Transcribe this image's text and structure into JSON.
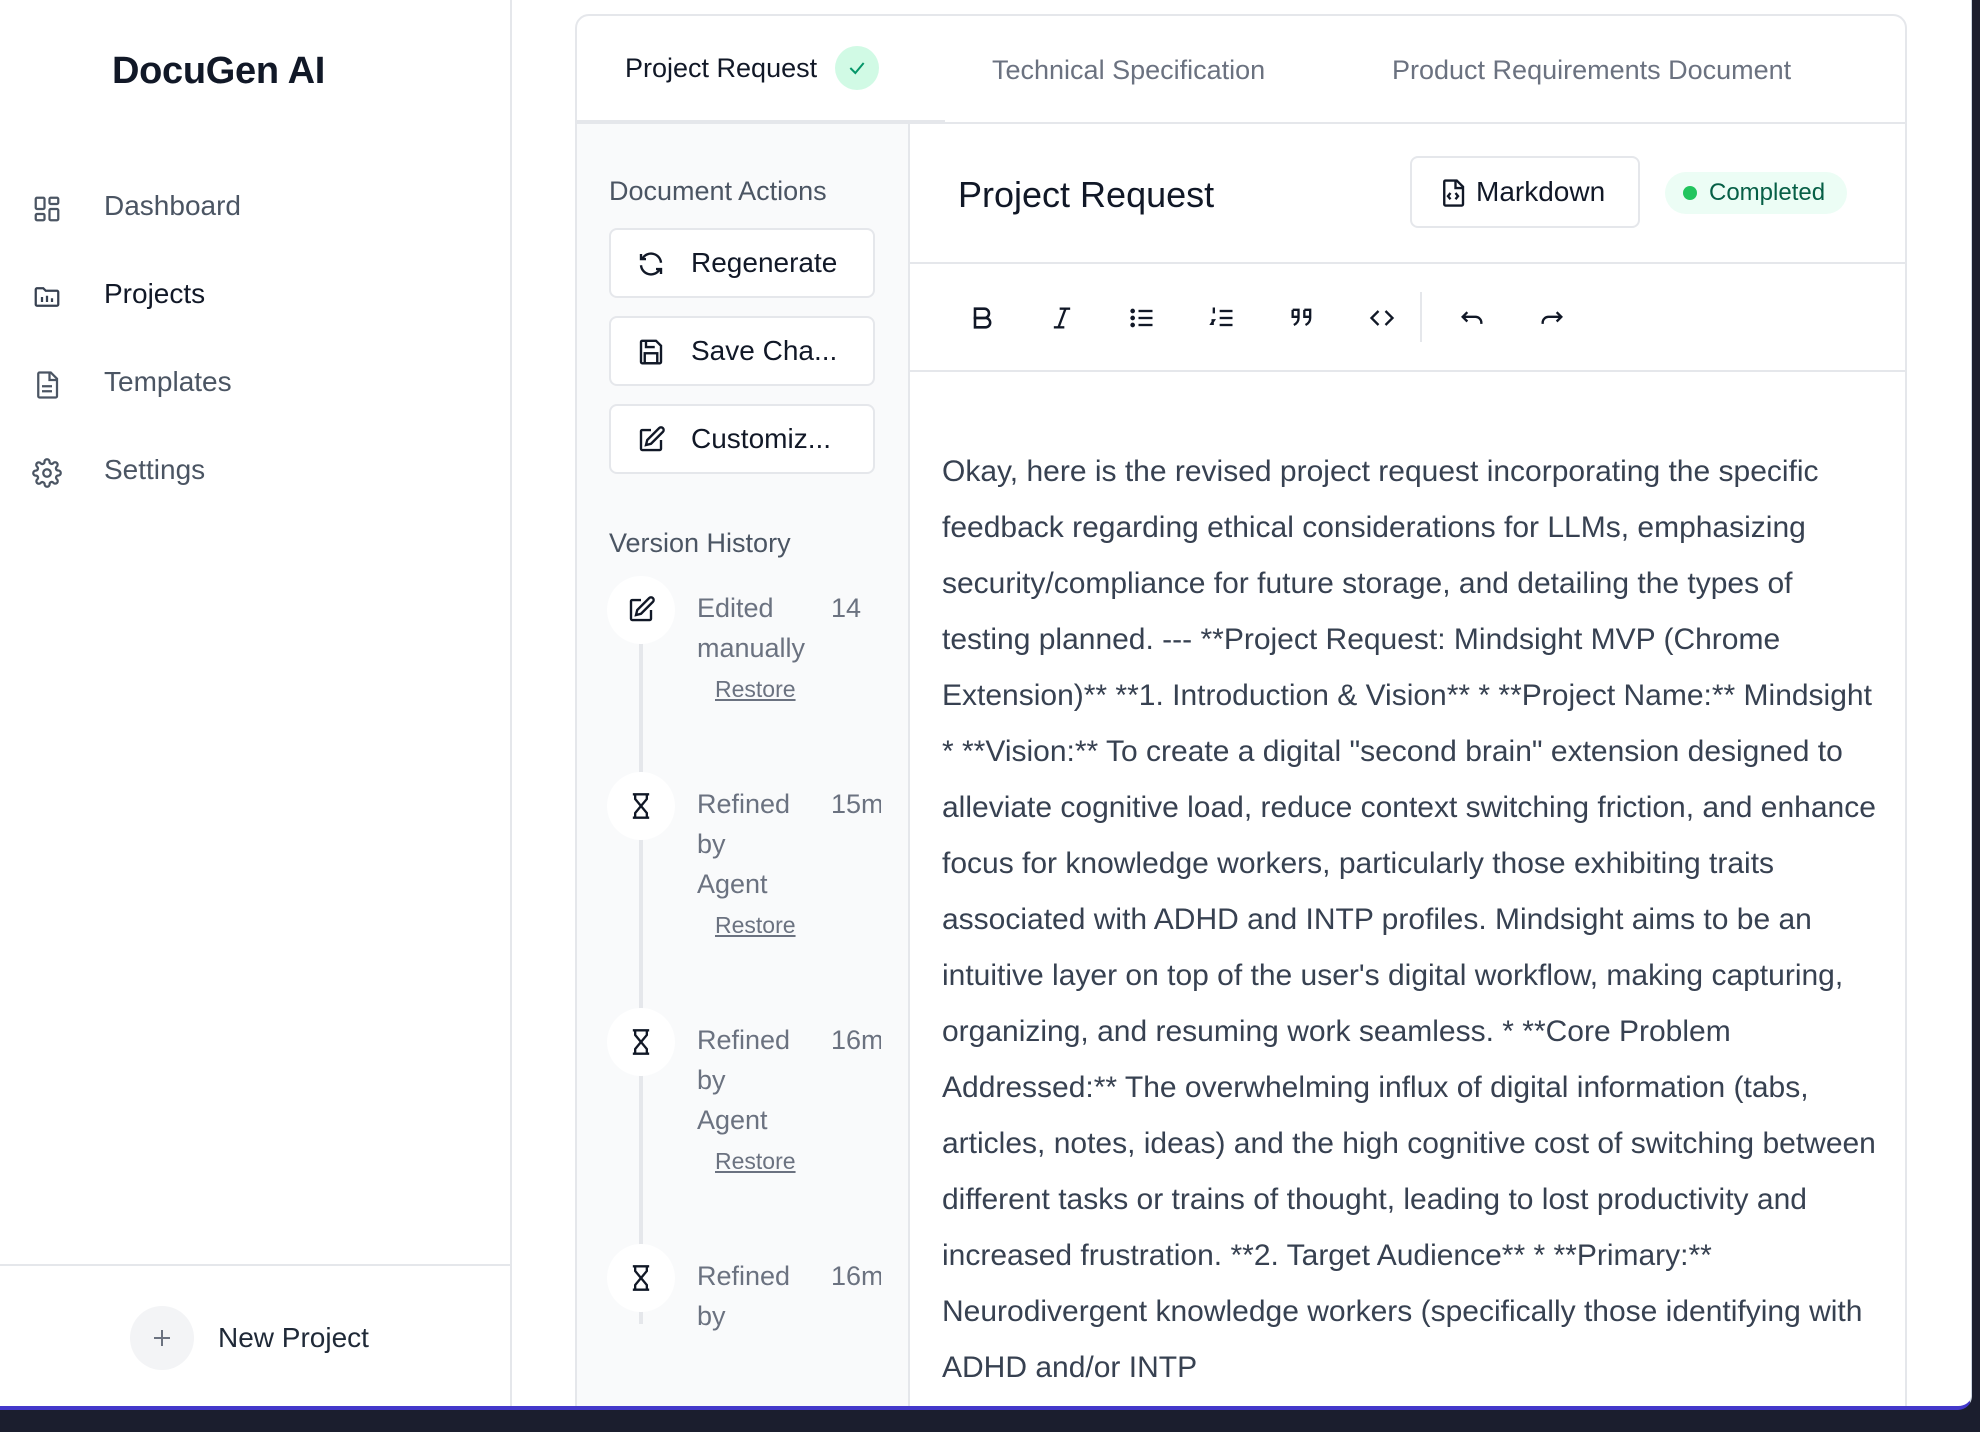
{
  "app": {
    "title": "DocuGen AI"
  },
  "sidebar": {
    "items": [
      {
        "label": "Dashboard",
        "icon": "dashboard-icon"
      },
      {
        "label": "Projects",
        "icon": "folder-icon"
      },
      {
        "label": "Templates",
        "icon": "document-icon"
      },
      {
        "label": "Settings",
        "icon": "gear-icon"
      }
    ],
    "active": "Projects",
    "new_project_label": "New Project"
  },
  "tabs": [
    {
      "label": "Project Request",
      "active": true,
      "completed": true
    },
    {
      "label": "Technical Specification",
      "active": false
    },
    {
      "label": "Product Requirements Document",
      "active": false
    }
  ],
  "actions": {
    "title": "Document Actions",
    "buttons": [
      {
        "label": "Regenerate",
        "icon": "refresh-icon"
      },
      {
        "label": "Save Cha...",
        "icon": "save-icon"
      },
      {
        "label": "Customiz...",
        "icon": "edit-icon"
      }
    ]
  },
  "version_history": {
    "title": "Version History",
    "items": [
      {
        "lines": [
          "Edited",
          "manually"
        ],
        "time": "14",
        "icon": "edit-icon",
        "restore": "Restore"
      },
      {
        "lines": [
          "Refined",
          "by",
          "Agent"
        ],
        "time": "15m",
        "icon": "hourglass-icon",
        "restore": "Restore"
      },
      {
        "lines": [
          "Refined",
          "by",
          "Agent"
        ],
        "time": "16m",
        "icon": "hourglass-icon",
        "restore": "Restore"
      },
      {
        "lines": [
          "Refined",
          "by"
        ],
        "time": "16m",
        "icon": "hourglass-icon"
      }
    ]
  },
  "document": {
    "title": "Project Request",
    "format_button": "Markdown",
    "status": "Completed",
    "status_color": "#22c55e",
    "body": "Okay, here is the revised project request incorporating the specific feedback regarding ethical considerations for LLMs, emphasizing security/compliance for future storage, and detailing the types of testing planned. --- **Project Request: Mindsight MVP (Chrome Extension)** **1. Introduction & Vision** * **Project Name:** Mindsight * **Vision:** To create a digital \"second brain\" extension designed to alleviate cognitive load, reduce context switching friction, and enhance focus for knowledge workers, particularly those exhibiting traits associated with ADHD and INTP profiles. Mindsight aims to be an intuitive layer on top of the user's digital workflow, making capturing, organizing, and resuming work seamless. * **Core Problem Addressed:** The overwhelming influx of digital information (tabs, articles, notes, ideas) and the high cognitive cost of switching between different tasks or trains of thought, leading to lost productivity and increased frustration. **2. Target Audience** * **Primary:** Neurodivergent knowledge workers (specifically those identifying with ADHD and/or INTP"
  },
  "toolbar": {
    "tools": [
      "bold-icon",
      "italic-icon",
      "bullet-list-icon",
      "numbered-list-icon",
      "quote-icon",
      "code-icon",
      "undo-icon",
      "redo-icon"
    ]
  },
  "colors": {
    "accent_border": "#4338ca",
    "completed_bg": "#d1fae5",
    "completed_text": "#065f46"
  }
}
